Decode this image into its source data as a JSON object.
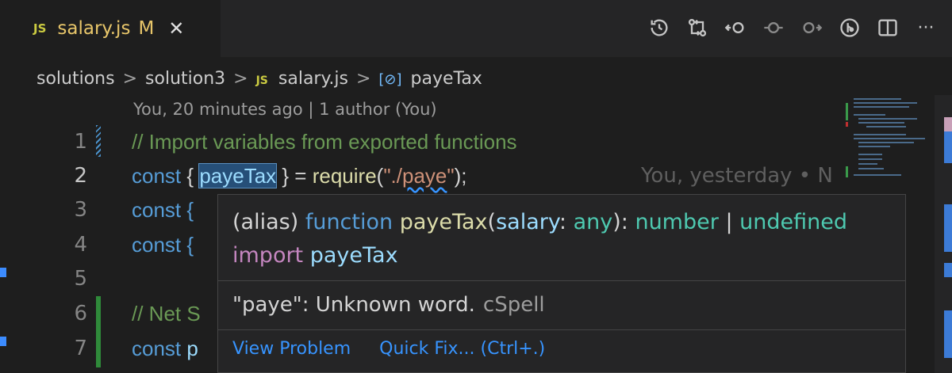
{
  "tab": {
    "badge": "JS",
    "title": "salary.js",
    "modified": "M",
    "close": "✕"
  },
  "actions": [
    {
      "icon": "history-icon"
    },
    {
      "icon": "compare-changes-icon"
    },
    {
      "icon": "previous-change-icon"
    },
    {
      "icon": "current-change-icon"
    },
    {
      "icon": "next-change-icon"
    },
    {
      "icon": "git-timeline-icon"
    },
    {
      "icon": "split-editor-icon"
    },
    {
      "icon": "more-actions-icon",
      "glyph": "···"
    }
  ],
  "breadcrumb": {
    "items": [
      "solutions",
      "solution3",
      "salary.js",
      "payeTax"
    ],
    "sep": ">",
    "js_badge": "JS",
    "symbol_glyph": "[⊘]"
  },
  "codelens": "You, 20 minutes ago | 1 author (You)",
  "lines": [
    {
      "num": "1",
      "text": "// Import variables from exported functions"
    },
    {
      "num": "2",
      "const": "const",
      "lb": "{",
      "var": "payeTax",
      "rb": "} =",
      "fn": "require",
      "open": "(",
      "str1": "\"./",
      "str2": "paye",
      "str3": "\"",
      "close": ");",
      "blame": "You, yesterday • N"
    },
    {
      "num": "3",
      "text": "const {"
    },
    {
      "num": "4",
      "text": "const {"
    },
    {
      "num": "5",
      "text": ""
    },
    {
      "num": "6",
      "text": "// Net S"
    },
    {
      "num": "7",
      "kw": "const",
      "rest": "p"
    }
  ],
  "hover": {
    "alias": "(alias)",
    "function_kw": "function",
    "fn_name": "payeTax",
    "param_open": "(",
    "param": "salary",
    "colon": ":",
    "param_type": "any",
    "close": "):",
    "ret1": "number",
    "pipe": "|",
    "ret2": "undefined",
    "import_kw": "import",
    "import_name": "payeTax",
    "problem": "\"paye\": Unknown word.",
    "source": "cSpell",
    "view_problem": "View Problem",
    "quick_fix": "Quick Fix... (Ctrl+.)"
  }
}
